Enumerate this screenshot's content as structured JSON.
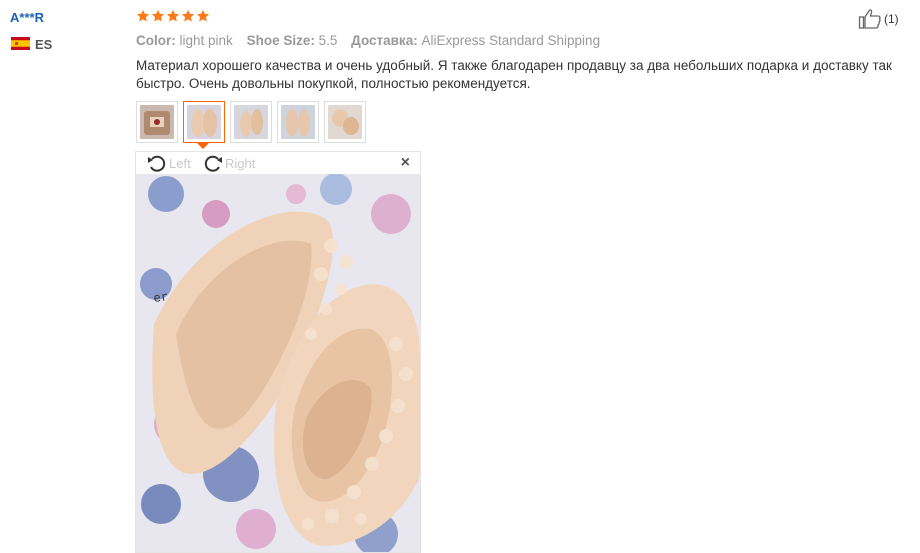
{
  "reviewer": {
    "name": "A***R",
    "country": "ES"
  },
  "rating": {
    "stars": 5,
    "max": 5,
    "star_color": "#ff7a1a"
  },
  "attributes": [
    {
      "label": "Color:",
      "value": "light pink"
    },
    {
      "label": "Shoe Size:",
      "value": "5.5"
    },
    {
      "label": "Доставка:",
      "value": "AliExpress Standard Shipping"
    }
  ],
  "review_text": "Материал хорошего качества и очень удобный. Я также благодарен продавцу за два небольших подарка и доставку так быстро. Очень довольны покупкой, полностью рекомендуется.",
  "thumbnails": [
    {
      "id": "thumb-1",
      "active": false
    },
    {
      "id": "thumb-2",
      "active": true
    },
    {
      "id": "thumb-3",
      "active": false
    },
    {
      "id": "thumb-4",
      "active": false
    },
    {
      "id": "thumb-5",
      "active": false
    }
  ],
  "viewer": {
    "rotate_left": "Left",
    "rotate_right": "Right",
    "close": "×"
  },
  "helpful": {
    "count": "(1)"
  },
  "icons": {
    "star": "star-icon",
    "thumbs_up": "thumbs-up-icon",
    "rotate_left": "rotate-left-icon",
    "rotate_right": "rotate-right-icon",
    "close": "close-icon",
    "flag": "spain-flag-icon"
  },
  "colors": {
    "accent": "#ff6600",
    "link": "#1b64b4"
  }
}
